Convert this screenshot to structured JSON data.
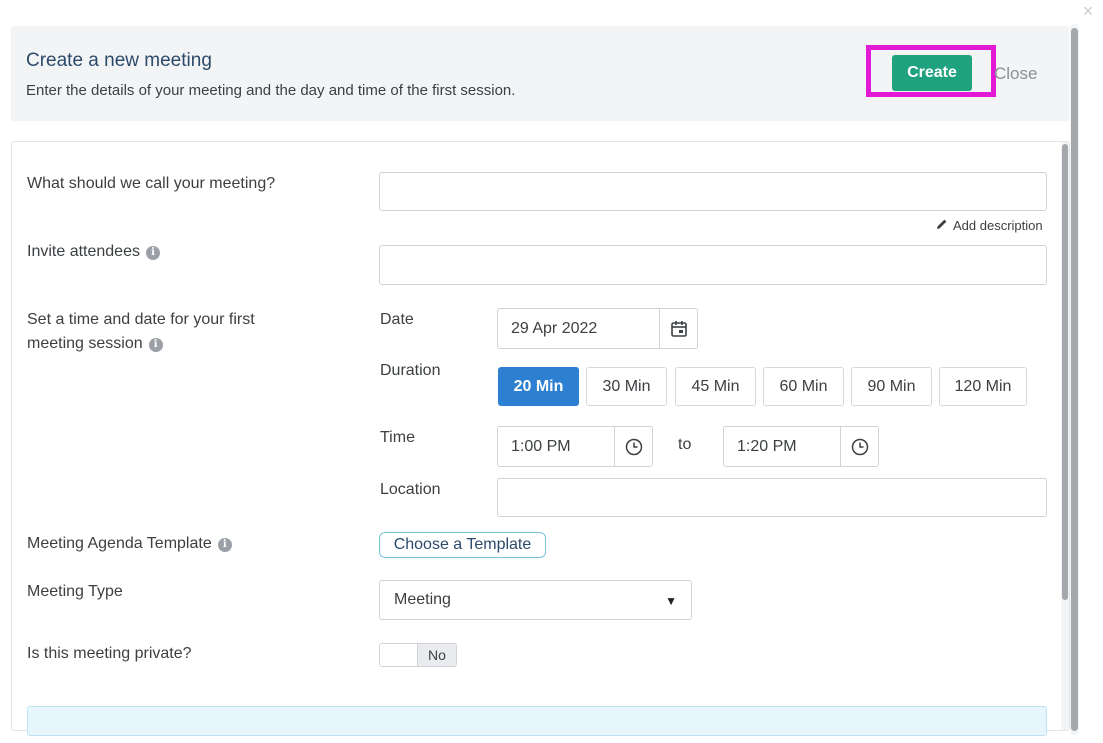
{
  "header": {
    "title": "Create a new meeting",
    "subtitle": "Enter the details of your meeting and the day and time of the first session.",
    "create_label": "Create",
    "close_label": "Close"
  },
  "form": {
    "name_label": "What should we call your meeting?",
    "name_value": "",
    "add_description": "Add description",
    "attendees_label": "Invite attendees",
    "attendees_value": "",
    "session_label_line1": "Set a time and date for your first",
    "session_label_line2": "meeting session",
    "date_label": "Date",
    "date_value": "29 Apr 2022",
    "duration_label": "Duration",
    "durations": [
      "20 Min",
      "30 Min",
      "45 Min",
      "60 Min",
      "90 Min",
      "120 Min"
    ],
    "selected_duration": "20 Min",
    "time_label": "Time",
    "time_from": "1:00 PM",
    "time_to_label": "to",
    "time_to": "1:20 PM",
    "location_label": "Location",
    "location_value": "",
    "agenda_label": "Meeting Agenda Template",
    "agenda_button": "Choose a Template",
    "type_label": "Meeting Type",
    "type_value": "Meeting",
    "private_label": "Is this meeting private?",
    "private_value": "No"
  },
  "icons": {
    "info": "info-icon",
    "calendar": "calendar-icon",
    "clock": "clock-icon",
    "pencil": "pencil-icon",
    "caret": "caret-down-icon",
    "close": "close-icon"
  },
  "colors": {
    "create_button": "#1fa37e",
    "highlight": "#e21ad6",
    "selected_duration": "#2d7fd1",
    "title": "#2d4a6b"
  }
}
